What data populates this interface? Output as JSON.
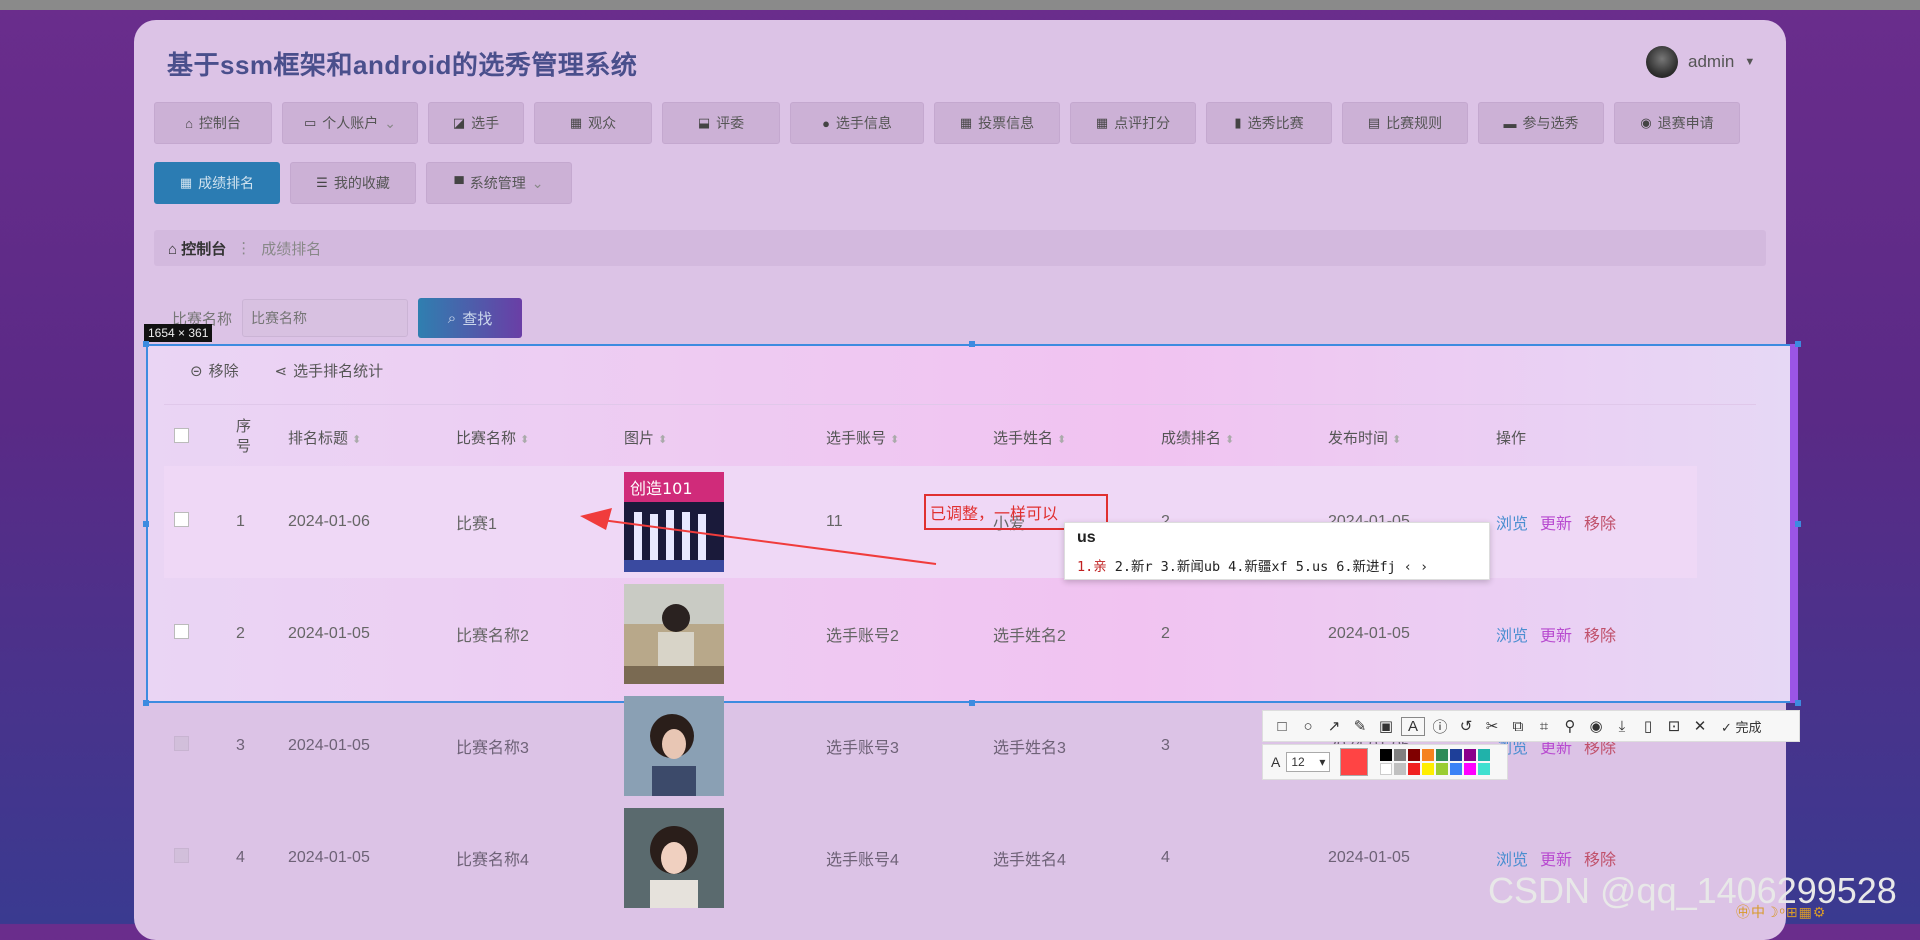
{
  "app": {
    "title": "基于ssm框架和android的选秀管理系统",
    "user": "admin"
  },
  "nav": {
    "row1": [
      {
        "label": "控制台",
        "icon": "home-icon",
        "glyph": "⌂",
        "w": 118
      },
      {
        "label": "个人账户",
        "icon": "window-icon",
        "glyph": "▭",
        "w": 136,
        "caret": true
      },
      {
        "label": "选手",
        "icon": "chart-icon",
        "glyph": "◪",
        "w": 96
      },
      {
        "label": "观众",
        "icon": "grid-icon",
        "glyph": "▦",
        "w": 118
      },
      {
        "label": "评委",
        "icon": "import-icon",
        "glyph": "⬓",
        "w": 118
      },
      {
        "label": "选手信息",
        "icon": "user-icon",
        "glyph": "●",
        "w": 134
      },
      {
        "label": "投票信息",
        "icon": "grid-icon",
        "glyph": "▦",
        "w": 126
      },
      {
        "label": "点评打分",
        "icon": "table-icon",
        "glyph": "▦",
        "w": 126
      },
      {
        "label": "选秀比赛",
        "icon": "bar-chart-icon",
        "glyph": "▮",
        "w": 126
      },
      {
        "label": "比赛规则",
        "icon": "briefcase-icon",
        "glyph": "▤",
        "w": 126
      },
      {
        "label": "参与选秀",
        "icon": "device-icon",
        "glyph": "▬",
        "w": 126
      },
      {
        "label": "退赛申请",
        "icon": "pin-icon",
        "glyph": "◉",
        "w": 126
      }
    ],
    "row2": [
      {
        "label": "成绩排名",
        "icon": "grid-icon",
        "glyph": "▦",
        "w": 126,
        "active": true
      },
      {
        "label": "我的收藏",
        "icon": "sliders-icon",
        "glyph": "☰",
        "w": 126
      },
      {
        "label": "系统管理",
        "icon": "monitor-icon",
        "glyph": "▀",
        "w": 146,
        "caret": true
      }
    ]
  },
  "breadcrumb": {
    "home": "控制台",
    "separator": "⋮",
    "current": "成绩排名"
  },
  "search": {
    "label": "比赛名称",
    "placeholder": "比赛名称",
    "button": "查找"
  },
  "selection_badge": "1654 × 361",
  "toolbar": {
    "remove": "移除",
    "stats": "选手排名统计"
  },
  "table": {
    "headers": [
      "序号",
      "排名标题",
      "比赛名称",
      "图片",
      "选手账号",
      "选手姓名",
      "成绩排名",
      "发布时间",
      "操作"
    ],
    "rows": [
      {
        "no": "1",
        "title": "2024-01-06",
        "match": "比赛1",
        "account": "11",
        "name": "小爱",
        "rank": "2",
        "time": "2024-01-05"
      },
      {
        "no": "2",
        "title": "2024-01-05",
        "match": "比赛名称2",
        "account": "选手账号2",
        "name": "选手姓名2",
        "rank": "2",
        "time": "2024-01-05"
      },
      {
        "no": "3",
        "title": "2024-01-05",
        "match": "比赛名称3",
        "account": "选手账号3",
        "name": "选手姓名3",
        "rank": "3",
        "time": "2024-01-05"
      },
      {
        "no": "4",
        "title": "2024-01-05",
        "match": "比赛名称4",
        "account": "选手账号4",
        "name": "选手姓名4",
        "rank": "4",
        "time": "2024-01-05"
      }
    ],
    "actions": {
      "view": "浏览",
      "update": "更新",
      "remove": "移除"
    }
  },
  "annotation": "已调整，一样可以",
  "ime": {
    "composition": "us",
    "candidates": [
      "1.亲",
      "2.新r",
      "3.新闻ub",
      "4.新疆xf",
      "5.us",
      "6.新进fj"
    ]
  },
  "screenshot_tool": {
    "done": "完成",
    "font_size": "12"
  },
  "watermark": "CSDN @qq_1406299528",
  "corner_text": "㊥中☽ᵒ⊞▦⚙",
  "colors": {
    "accent": "#2b7cb3",
    "annotation": "#e03030",
    "selection_border": "#3d8be0"
  }
}
